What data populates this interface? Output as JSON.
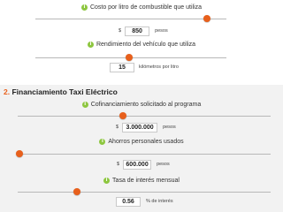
{
  "section1": {
    "fuel_cost": {
      "label": "Costo por litro de combustible que utiliza",
      "prefix": "$",
      "value": "850",
      "unit": "pesos",
      "slider_level": 0.8
    },
    "vehicle_yield": {
      "label": "Rendimiento del vehículo que utiliza",
      "value": "15",
      "unit": "kilómetros por litro",
      "slider_level": 0.49
    }
  },
  "section2": {
    "number": "2.",
    "title": "Financiamiento Taxi Eléctrico",
    "cofinancing": {
      "label": "Cofinanciamiento solicitado al programa",
      "prefix": "$",
      "value": "3.000.000",
      "unit": "pesos",
      "slider_level": 0.38
    },
    "savings": {
      "label": "Ahorros personales usados",
      "prefix": "$",
      "value": "600.000",
      "unit": "pesos",
      "slider_level": 0.05
    },
    "interest": {
      "label": "Tasa de interés mensual",
      "value": "0.56",
      "unit": "% de interés",
      "slider_level": 0.09
    }
  },
  "colors": {
    "accent": "#e8601c",
    "info_icon": "#8dc63f",
    "section_bg": "#f2f2f2"
  },
  "icons": {
    "info": "i"
  }
}
